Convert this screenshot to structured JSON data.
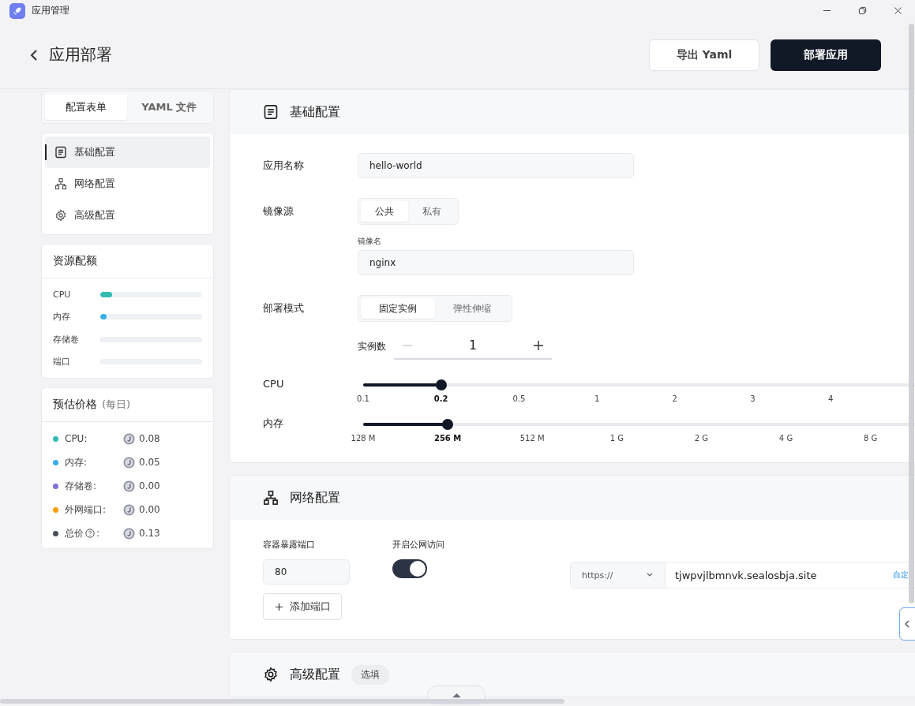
{
  "app_title": "应用管理",
  "header": {
    "title": "应用部署",
    "buttons": [
      {
        "label": "导出 Yaml",
        "kind": "secondary"
      },
      {
        "label": "部署应用",
        "kind": "primary"
      }
    ]
  },
  "form_tabs": [
    {
      "label": "配置表单",
      "selected": true
    },
    {
      "label": "YAML 文件",
      "selected": false
    }
  ],
  "nav": [
    {
      "label": "基础配置",
      "kind": "doc",
      "selected": true
    },
    {
      "label": "网络配置",
      "kind": "network",
      "selected": false
    },
    {
      "label": "高级配置",
      "kind": "gear",
      "selected": false
    }
  ],
  "quota": {
    "title": "资源配额",
    "items": [
      {
        "label": "CPU",
        "level": 0.12,
        "color": "#33bbb1"
      },
      {
        "label": "内存",
        "level": 0.06,
        "color": "#36adef"
      },
      {
        "label": "存储卷",
        "level": 0
      },
      {
        "label": "端口",
        "level": 0
      }
    ]
  },
  "price": {
    "title": "预估价格",
    "note": "(每日)",
    "items": [
      {
        "label": "CPU:",
        "value": "0.08",
        "color": "#33bbb1"
      },
      {
        "label": "内存:",
        "value": "0.05",
        "color": "#36adef"
      },
      {
        "label": "存储卷:",
        "value": "0.00",
        "color": "#8172d8"
      },
      {
        "label": "外网端口:",
        "value": "0.00",
        "color": "#fb9e00"
      },
      {
        "label": "总价",
        "help": true,
        "after_help": ":",
        "value": "0.13",
        "color": "#485058"
      }
    ]
  },
  "basic": {
    "title": "基础配置",
    "app_name": {
      "label": "应用名称",
      "value": "hello-world"
    },
    "image_source": {
      "label": "镜像源",
      "options": [
        {
          "label": "公共",
          "selected": true
        },
        {
          "label": "私有",
          "selected": false
        }
      ],
      "image_label": "镜像名",
      "image_value": "nginx"
    },
    "mode": {
      "label": "部署模式",
      "options": [
        {
          "label": "固定实例",
          "selected": true
        },
        {
          "label": "弹性伸缩",
          "selected": false
        }
      ],
      "count_label": "实例数",
      "count": "1"
    },
    "sliders": [
      {
        "label": "CPU",
        "level": 0.141,
        "ticks": [
          {
            "label": "0.1",
            "selected": false
          },
          {
            "label": "0.2",
            "selected": true
          },
          {
            "label": "0.5",
            "selected": false
          },
          {
            "label": "1",
            "selected": false
          },
          {
            "label": "2",
            "selected": false
          },
          {
            "label": "3",
            "selected": false
          },
          {
            "label": "4",
            "selected": false
          }
        ]
      },
      {
        "label": "内存",
        "level": 0.153,
        "ticks": [
          {
            "label": "128 M",
            "selected": false
          },
          {
            "label": "256 M",
            "selected": true
          },
          {
            "label": "512 M",
            "selected": false
          },
          {
            "label": "1 G",
            "selected": false
          },
          {
            "label": "2 G",
            "selected": false
          },
          {
            "label": "4 G",
            "selected": false
          },
          {
            "label": "8 G",
            "selected": false
          }
        ]
      }
    ]
  },
  "network": {
    "title": "网络配置",
    "port_label": "容器暴露端口",
    "port": "80",
    "public_label": "开启公网访问",
    "public_on": true,
    "protocol": "https://",
    "domain": "tjwpvjlbmnvk.sealosbja.site",
    "custom_link": "自定",
    "add_port": "添加端口"
  },
  "advanced": {
    "title": "高级配置",
    "badge": "选填"
  }
}
